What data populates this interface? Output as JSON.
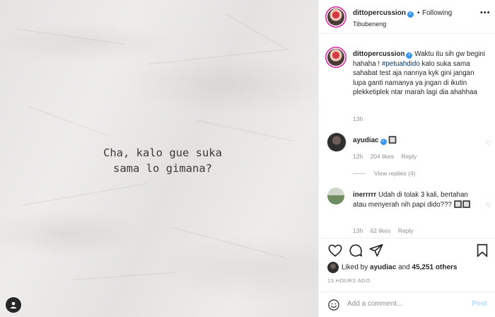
{
  "photo": {
    "text_line1": "Cha, kalo gue suka",
    "text_line2": "sama lo gimana?",
    "user_icon": "user-icon"
  },
  "header": {
    "username": "dittopercussion",
    "separator": "•",
    "follow_status": "Following",
    "location": "Tibubeneng",
    "more_icon": "more-icon"
  },
  "caption": {
    "username": "dittopercussion",
    "text_before": "Waktu itu sih gw begini hahaha !",
    "hashtag": "#petuahdido",
    "text_after": "kalo suka sama sahabat test aja nannya kyk gini jangan lupa ganti namanya ya jngan di ikutin plekketiplek ntar marah lagi dia ahahhaa",
    "time": "13h"
  },
  "comments": [
    {
      "username": "ayudiac",
      "text": "🔲",
      "time": "12h",
      "likes": "204 likes",
      "reply": "Reply",
      "view_replies": "View replies (4)"
    },
    {
      "username": "inerrrrr",
      "text": "Udah di tolak 3 kali, bertahan atau menyerah nih papi dido??? 🔲🔲",
      "time": "13h",
      "likes": "62 likes",
      "reply": "Reply"
    }
  ],
  "actions": {
    "liked_prefix": "Liked by",
    "liked_user": "ayudiac",
    "liked_and": "and",
    "liked_count": "45,251 others",
    "post_time": "13 HOURS AGO"
  },
  "add_comment": {
    "placeholder": "Add a comment...",
    "post_label": "Post"
  },
  "colors": {
    "accent": "#3897f0",
    "hashtag": "#00376b",
    "muted": "#8e8e8e",
    "post_disabled": "#b2dffc"
  }
}
